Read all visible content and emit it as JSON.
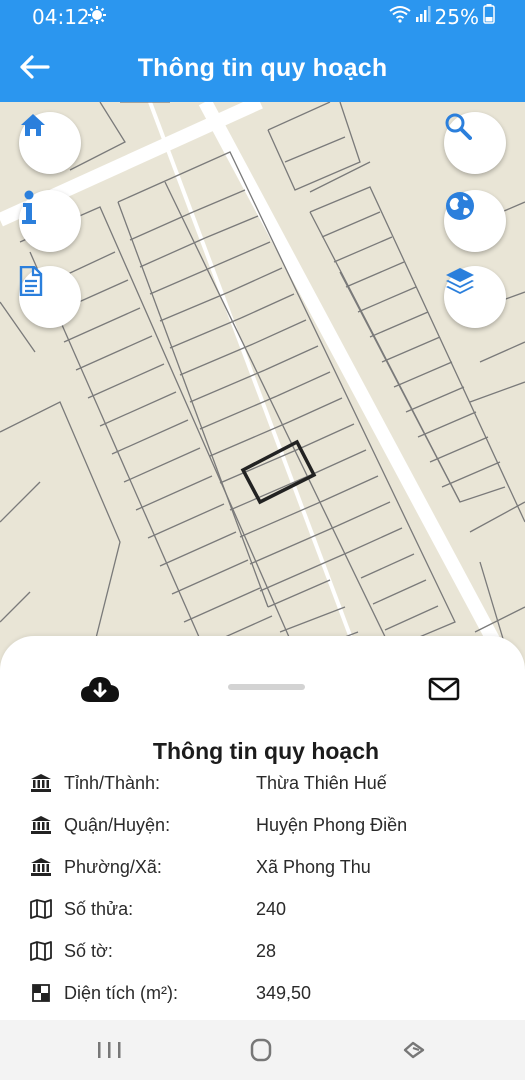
{
  "status_bar": {
    "time": "04:12",
    "battery": "25%"
  },
  "app_bar": {
    "title": "Thông tin quy hoạch"
  },
  "map": {
    "buttons_left": [
      "home-icon",
      "info-icon",
      "document-icon"
    ],
    "buttons_right": [
      "search-icon",
      "globe-icon",
      "layers-icon"
    ]
  },
  "sheet": {
    "title": "Thông tin quy hoạch",
    "rows": [
      {
        "icon": "bank-icon",
        "label": "Tỉnh/Thành:",
        "value": "Thừa Thiên Huế"
      },
      {
        "icon": "bank-icon",
        "label": "Quận/Huyện:",
        "value": "Huyện Phong Điền"
      },
      {
        "icon": "bank-icon",
        "label": "Phường/Xã:",
        "value": "Xã Phong Thu"
      },
      {
        "icon": "map-icon",
        "label": "Số thửa:",
        "value": "240"
      },
      {
        "icon": "map-icon",
        "label": "Số tờ:",
        "value": "28"
      },
      {
        "icon": "area-icon",
        "label": "Diện tích (m²):",
        "value": "349,50"
      }
    ]
  },
  "colors": {
    "primary": "#2b96ef",
    "map_bg": "#e9e5d6",
    "parcel_line": "#7a7a7a",
    "road": "#ffffff"
  }
}
